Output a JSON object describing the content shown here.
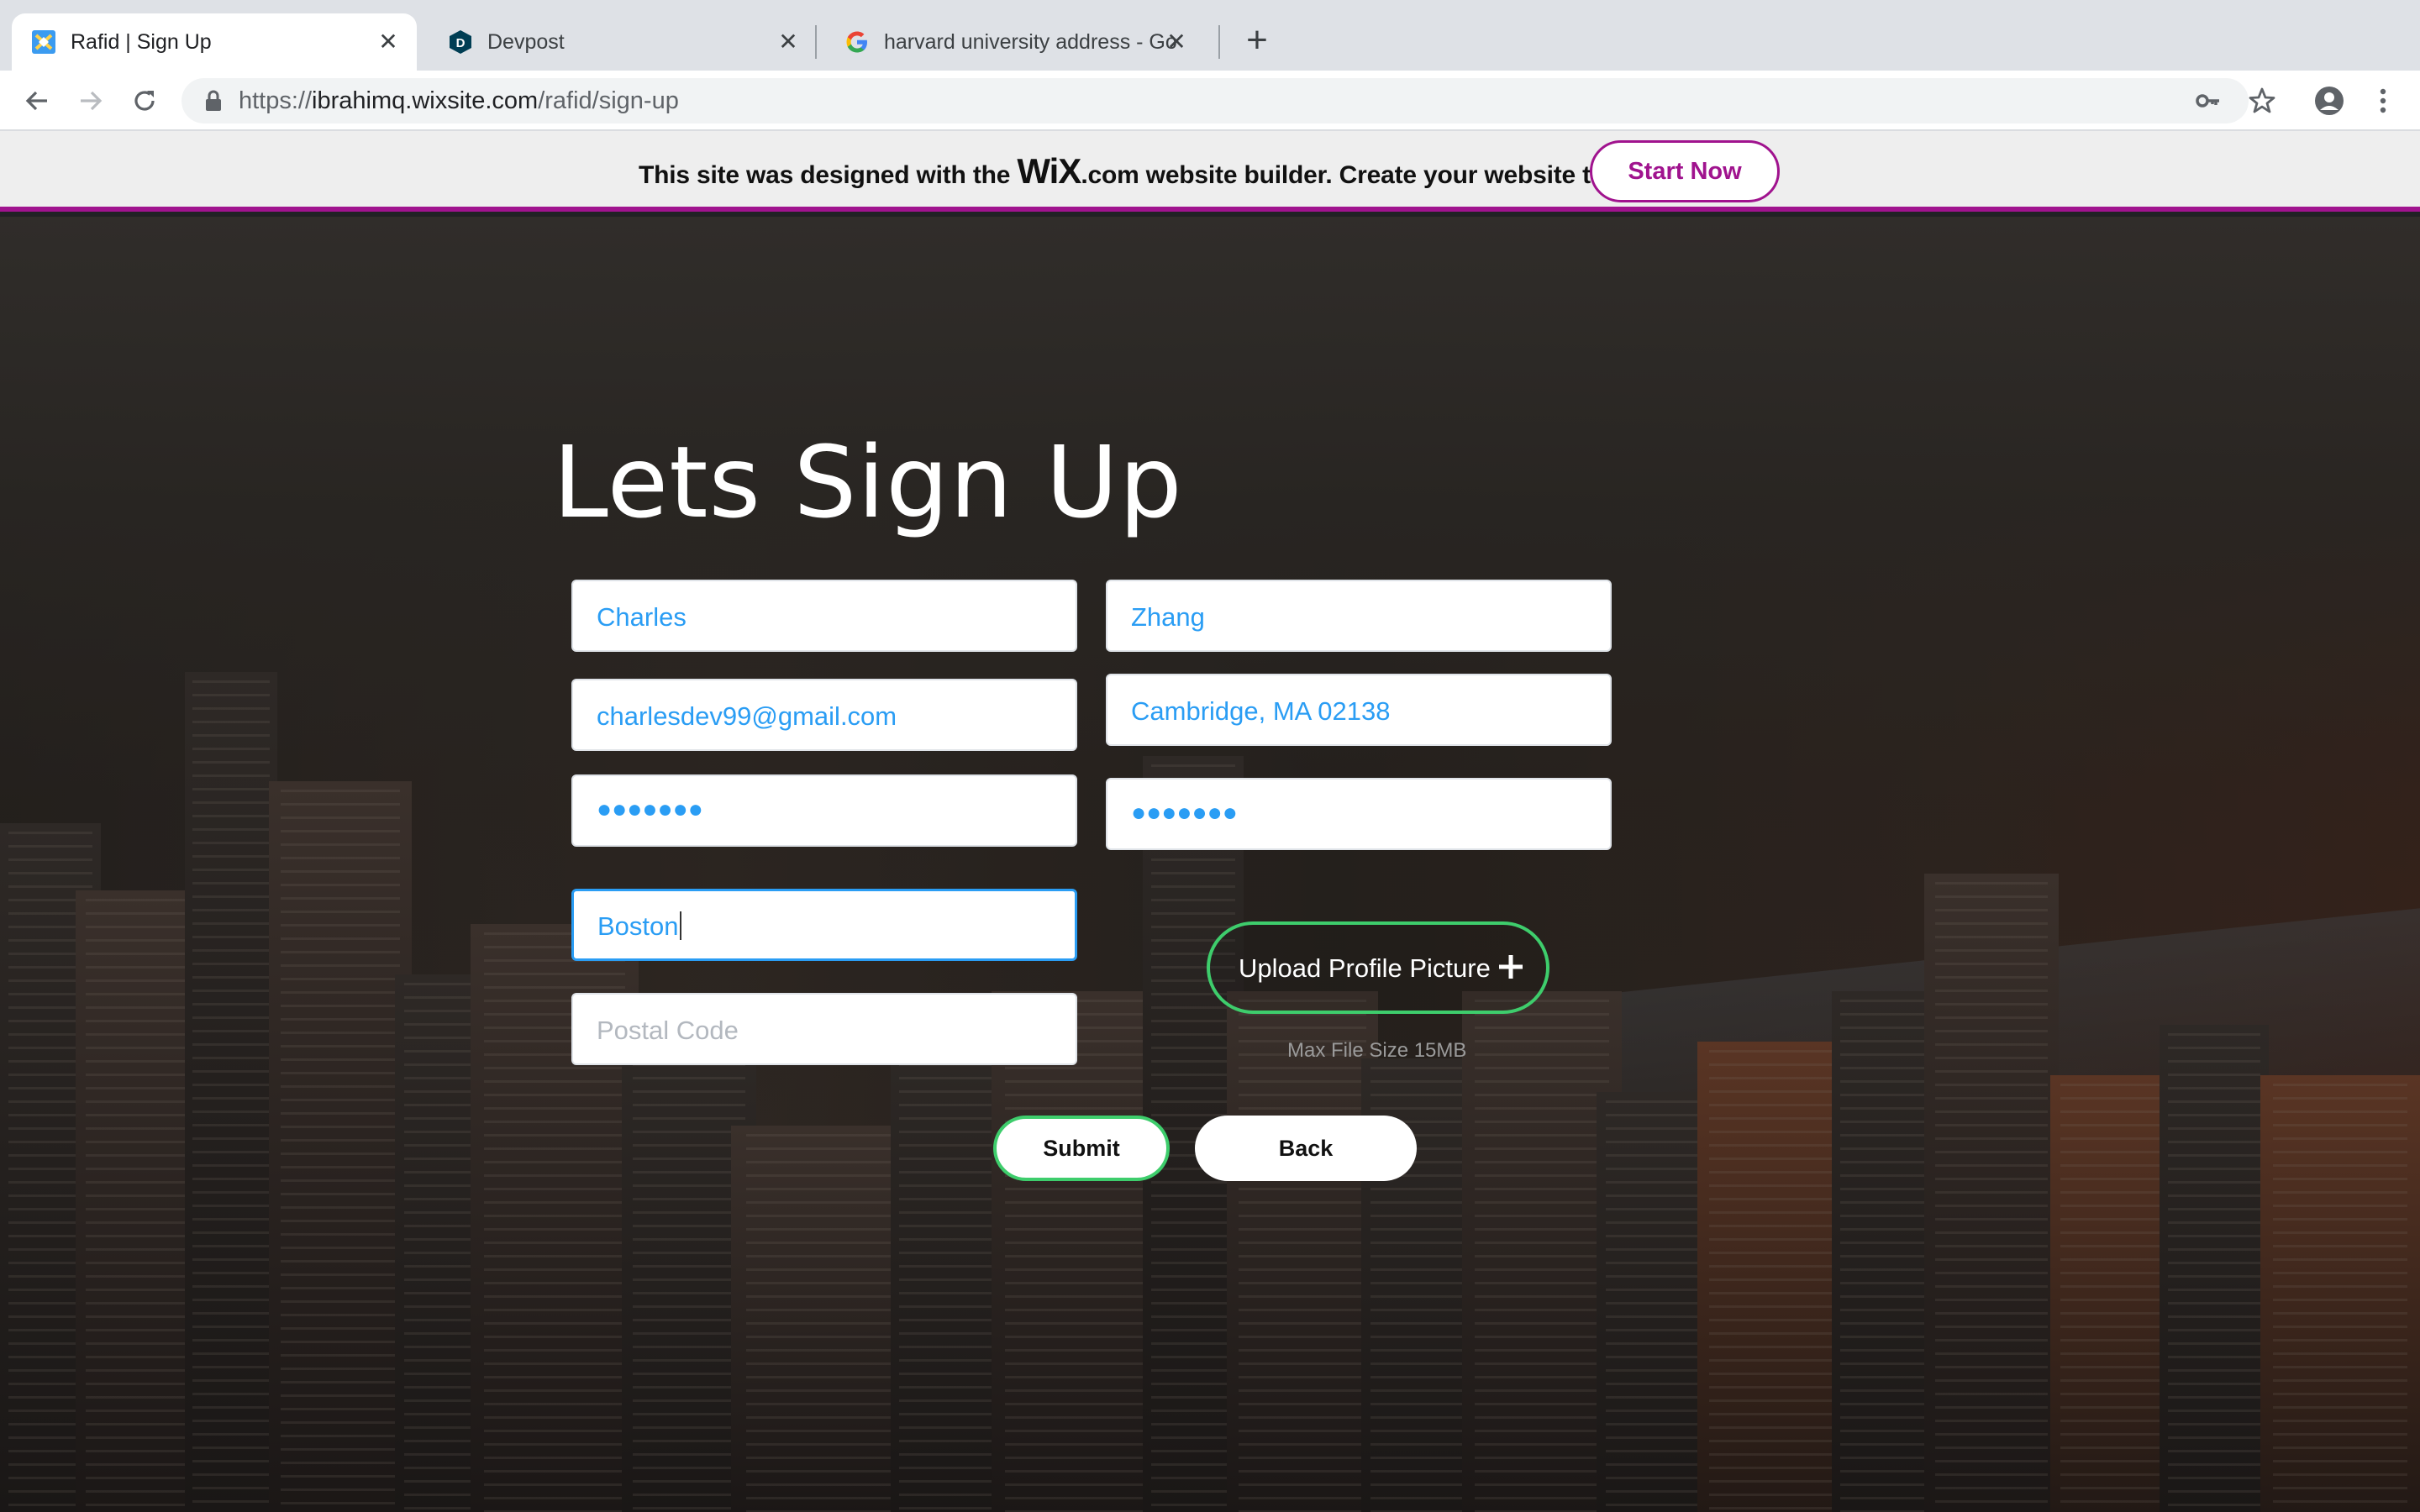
{
  "browser": {
    "tabs": [
      {
        "title": "Rafid | Sign Up",
        "icon": "wix-site-favicon",
        "active": true
      },
      {
        "title": "Devpost",
        "icon": "devpost-favicon",
        "active": false
      },
      {
        "title": "harvard university address - Go",
        "icon": "google-favicon",
        "active": false
      }
    ],
    "url": {
      "scheme": "https://",
      "host": "ibrahimq.wixsite.com",
      "path": "/rafid/sign-up"
    }
  },
  "wix_banner": {
    "message_before": "This site was designed with the ",
    "logo_text": "WiX",
    "message_after": ".com website builder. Create your website today.",
    "button_label": "Start Now",
    "accent_color": "#a0138e"
  },
  "form": {
    "title": "Lets Sign Up",
    "first_name": "Charles",
    "last_name": "Zhang",
    "email": "charlesdev99@gmail.com",
    "address": "Cambridge, MA 02138",
    "password_masked": "●●●●●●●",
    "confirm_password_masked": "●●●●●●●",
    "city": "Boston",
    "postal_code_placeholder": "Postal Code",
    "upload_label": "Upload Profile Picture",
    "max_file_size": "Max File Size 15MB",
    "submit_label": "Submit",
    "back_label": "Back",
    "value_color": "#2a9df4",
    "accent_green": "#3ecd6c"
  }
}
